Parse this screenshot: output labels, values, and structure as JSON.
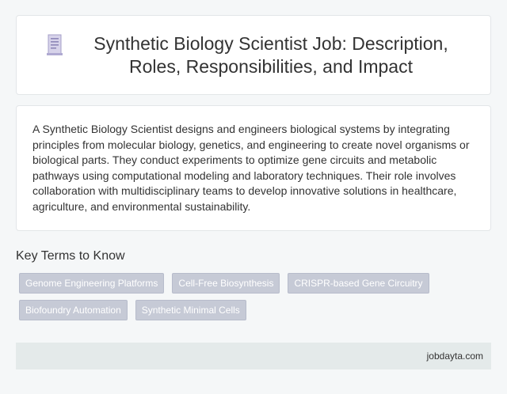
{
  "header": {
    "icon": "document-icon",
    "title": "Synthetic Biology Scientist Job: Description, Roles, Responsibilities, and Impact"
  },
  "description": "A Synthetic Biology Scientist designs and engineers biological systems by integrating principles from molecular biology, genetics, and engineering to create novel organisms or biological parts. They conduct experiments to optimize gene circuits and metabolic pathways using computational modeling and laboratory techniques. Their role involves collaboration with multidisciplinary teams to develop innovative solutions in healthcare, agriculture, and environmental sustainability.",
  "key_terms": {
    "heading": "Key Terms to Know",
    "items": [
      {
        "label": "Genome Engineering Platforms"
      },
      {
        "label": "Cell-Free Biosynthesis"
      },
      {
        "label": "CRISPR-based Gene Circuitry"
      },
      {
        "label": "Biofoundry Automation"
      },
      {
        "label": "Synthetic Minimal Cells"
      }
    ]
  },
  "footer": {
    "site": "jobdayta.com"
  },
  "colors": {
    "tag_background": "#c6cad6",
    "footer_background": "#e4eaea",
    "page_background": "#f5f7f8"
  }
}
